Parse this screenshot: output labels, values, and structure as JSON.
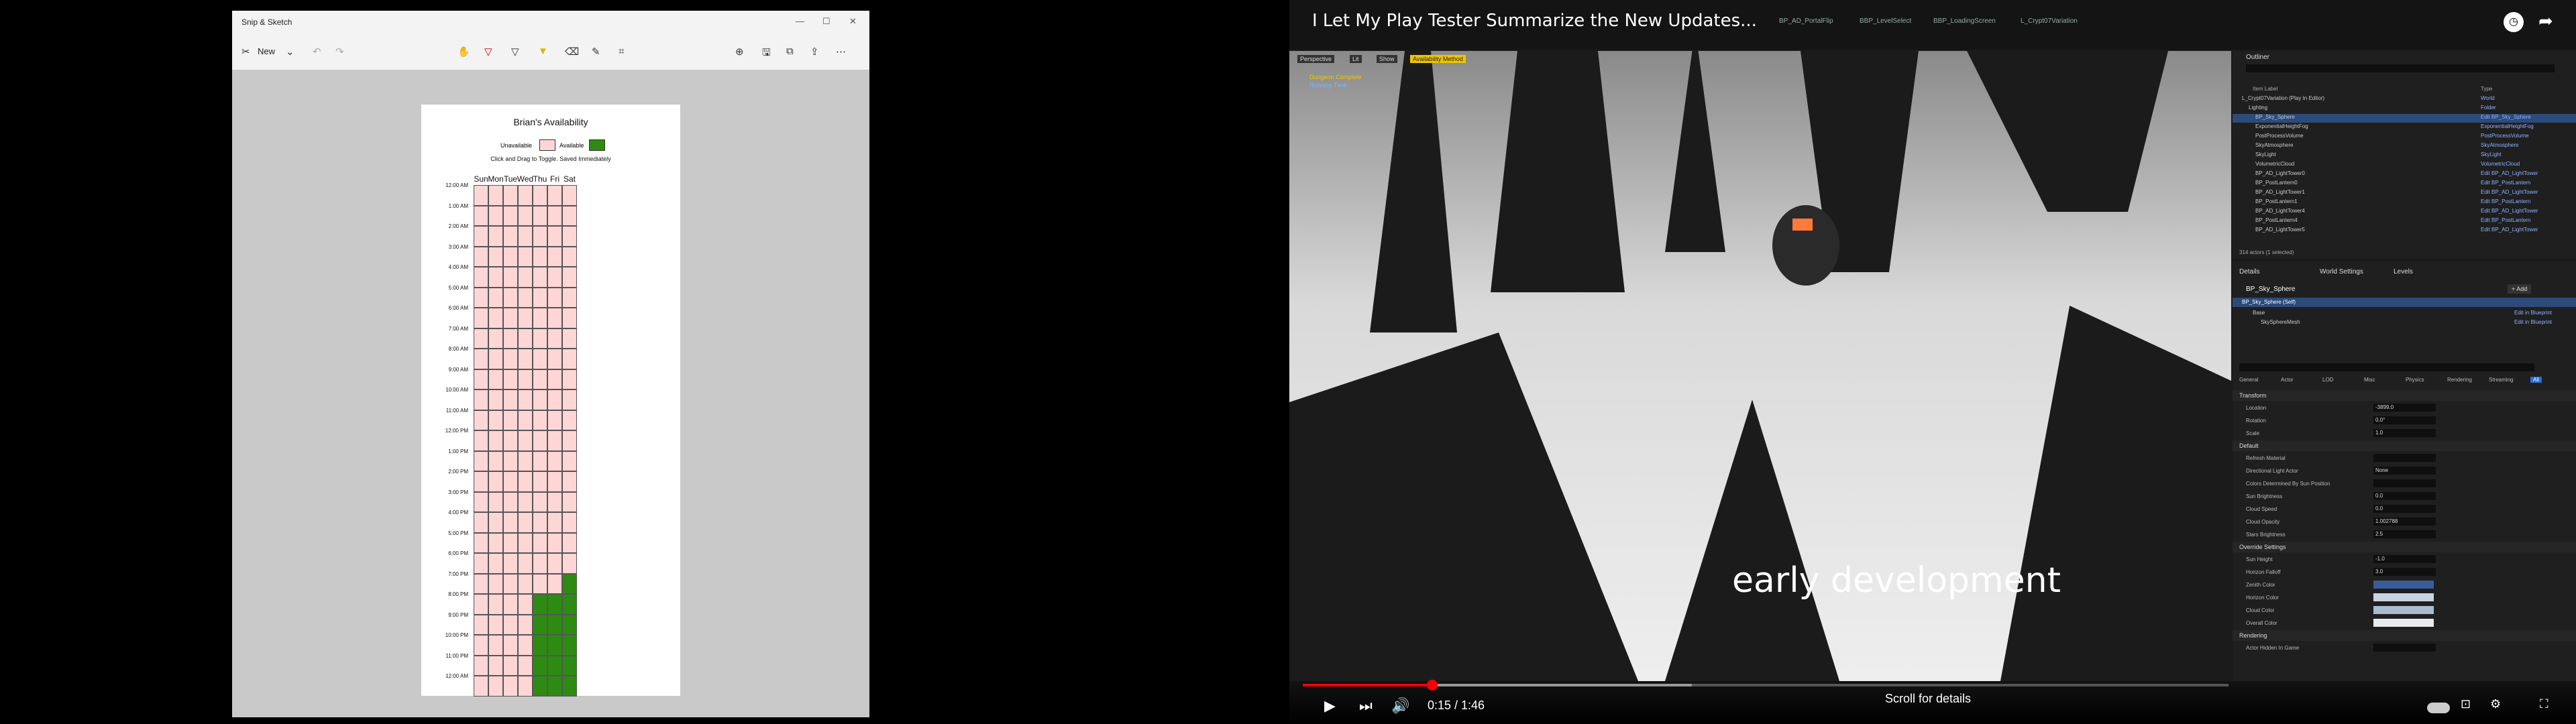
{
  "snip": {
    "title": "Snip & Sketch",
    "new_label": "New",
    "window_controls": [
      "—",
      "☐",
      "✕"
    ],
    "paper": {
      "title": "Brian's Availability",
      "legend_unavailable": "Unavailable",
      "legend_available": "Available",
      "instructions": "Click and Drag to Toggle. Saved Immediately",
      "days": [
        "Sun",
        "Mon",
        "Tue",
        "Wed",
        "Thu",
        "Fri",
        "Sat"
      ],
      "times": [
        "12:00 AM",
        "1:00 AM",
        "2:00 AM",
        "3:00 AM",
        "4:00 AM",
        "5:00 AM",
        "6:00 AM",
        "7:00 AM",
        "8:00 AM",
        "9:00 AM",
        "10:00 AM",
        "11:00 AM",
        "12:00 PM",
        "1:00 PM",
        "2:00 PM",
        "3:00 PM",
        "4:00 PM",
        "5:00 PM",
        "6:00 PM",
        "7:00 PM",
        "8:00 PM",
        "9:00 PM",
        "10:00 PM",
        "11:00 PM",
        "12:00 AM"
      ],
      "available_cells": [
        [
          21,
          6
        ],
        [
          22,
          4
        ],
        [
          22,
          5
        ],
        [
          22,
          6
        ],
        [
          23,
          4
        ],
        [
          23,
          5
        ],
        [
          23,
          6
        ],
        [
          24,
          4
        ],
        [
          24,
          5
        ],
        [
          24,
          6
        ],
        [
          25,
          4
        ],
        [
          25,
          5
        ],
        [
          25,
          6
        ],
        [
          26,
          4
        ],
        [
          26,
          5
        ],
        [
          26,
          6
        ]
      ],
      "colors": {
        "unavailable": "#ffd6d6",
        "available": "#2e8b12"
      }
    }
  },
  "video": {
    "title": "I Let My Play Tester Summarize the New Updates...",
    "subtitle": "early development",
    "time": "0:15 / 1:46",
    "scroll_hint": "Scroll for details",
    "progress": 0.14,
    "buffered": 0.42,
    "tabs": [
      "BP_AD_PortalFlip",
      "BBP_LevelSelect",
      "BBP_LoadingScreen",
      "L_Crypt07Variation"
    ],
    "viewport_labels": [
      "Perspective",
      "Lit",
      "Show",
      "Availability Method"
    ],
    "overlay_text": [
      "Dungeon Complete",
      "Running Time"
    ]
  },
  "outliner": {
    "title": "Outliner",
    "col_label": "Item Label",
    "col_type": "Type",
    "rows": [
      {
        "name": "L_Crypt07Variation (Play In Editor)",
        "type": "World"
      },
      {
        "name": "Lighting",
        "type": "Folder"
      },
      {
        "name": "BP_Sky_Sphere",
        "type": "Edit BP_Sky_Sphere",
        "sel": true
      },
      {
        "name": "ExponentialHeightFog",
        "type": "ExponentialHeightFog"
      },
      {
        "name": "PostProcessVolume",
        "type": "PostProcessVolume"
      },
      {
        "name": "SkyAtmosphere",
        "type": "SkyAtmosphere"
      },
      {
        "name": "SkyLight",
        "type": "SkyLight"
      },
      {
        "name": "VolumetricCloud",
        "type": "VolumetricCloud"
      },
      {
        "name": "BP_AD_LightTower0",
        "type": "Edit BP_AD_LightTower"
      },
      {
        "name": "BP_PostLantern0",
        "type": "Edit BP_PostLantern"
      },
      {
        "name": "BP_AD_LightTower1",
        "type": "Edit BP_AD_LightTower"
      },
      {
        "name": "BP_PostLantern1",
        "type": "Edit BP_PostLantern"
      },
      {
        "name": "BP_AD_LightTower4",
        "type": "Edit BP_AD_LightTower"
      },
      {
        "name": "BP_PostLantern4",
        "type": "Edit BP_PostLantern"
      },
      {
        "name": "BP_AD_LightTower5",
        "type": "Edit BP_AD_LightTower"
      }
    ],
    "count": "314 actors (1 selected)"
  },
  "details": {
    "tabs": [
      "Details",
      "World Settings",
      "Levels"
    ],
    "actor": "BP_Sky_Sphere",
    "self": "BP_Sky_Sphere (Self)",
    "components": [
      "Base",
      "SkySphereMesh"
    ],
    "add_label": "+ Add",
    "edit_bp": "Edit in Blueprint",
    "filter_tabs": [
      "General",
      "Actor",
      "LOD",
      "Misc",
      "Physics",
      "Rendering",
      "Streaming",
      "All"
    ],
    "sections": [
      {
        "name": "Transform",
        "props": [
          {
            "label": "Location",
            "value": "-3899.0"
          },
          {
            "label": "Rotation",
            "value": "0.0°"
          },
          {
            "label": "Scale",
            "value": "1.0"
          }
        ]
      },
      {
        "name": "Default",
        "props": [
          {
            "label": "Refresh Material",
            "value": ""
          },
          {
            "label": "Directional Light Actor",
            "value": "None"
          },
          {
            "label": "Colors Determined By Sun Position",
            "value": ""
          },
          {
            "label": "Sun Brightness",
            "value": "0.0"
          },
          {
            "label": "Cloud Speed",
            "value": "0.0"
          },
          {
            "label": "Cloud Opacity",
            "value": "1.002788"
          },
          {
            "label": "Stars Brightness",
            "value": "2.5"
          }
        ]
      },
      {
        "name": "Override Settings",
        "props": [
          {
            "label": "Sun Height",
            "value": "-1.0"
          },
          {
            "label": "Horizon Falloff",
            "value": "3.0"
          },
          {
            "label": "Zenith Color",
            "color": "#3a5c98"
          },
          {
            "label": "Horizon Color",
            "color": "#c9d4e2"
          },
          {
            "label": "Cloud Color",
            "color": "#a9bccf"
          },
          {
            "label": "Overall Color",
            "color": "#e9e9e9"
          }
        ]
      },
      {
        "name": "Rendering",
        "props": [
          {
            "label": "Actor Hidden In Game",
            "value": ""
          }
        ]
      }
    ]
  }
}
